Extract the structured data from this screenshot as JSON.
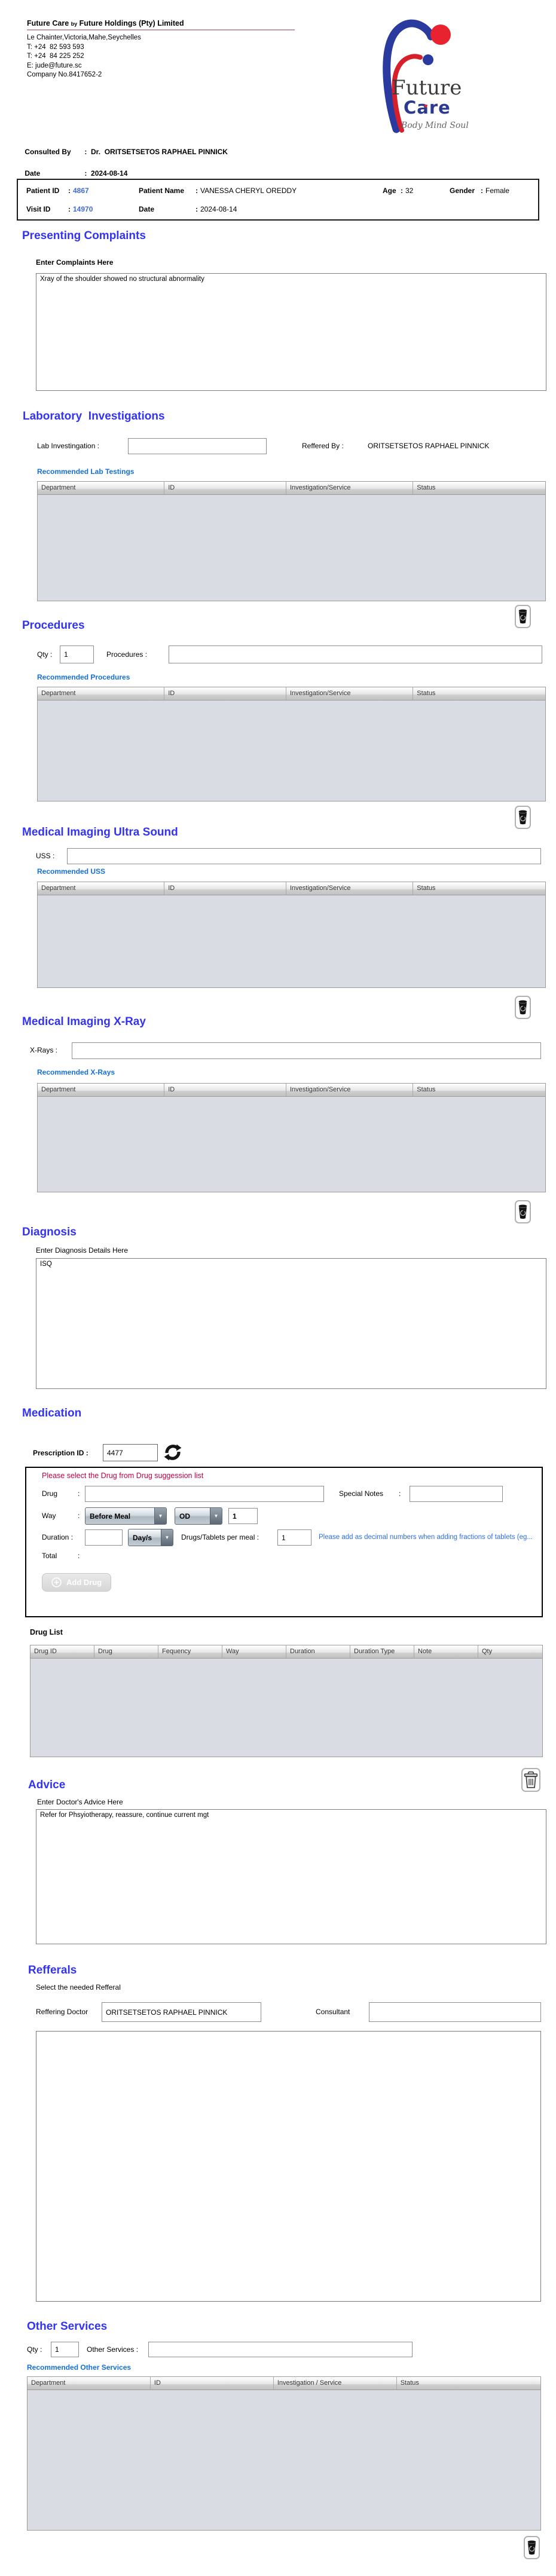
{
  "punct": {
    "colon": ":"
  },
  "colors": {
    "heading_blue": "#3333f2",
    "link_blue": "#156fd6",
    "warning_red": "#c30045",
    "note_blue": "#2e6de5",
    "id_blue": "#4169d8"
  },
  "header": {
    "company_name_1": "Future Care",
    "company_name_by": "by",
    "company_name_2": "Future Holdings (Pty) Limited",
    "address": "Le Chainter,Victoria,Mahe,Seychelles",
    "phone1": "T: +24  82 593 593",
    "phone2": "T: +24  84 225 252",
    "email": "E: jude@future.sc",
    "company_no": "Company No.8417652-2",
    "logo_title": "Future",
    "logo_subtitle": "Care",
    "logo_tagline": "Body Mind Soul"
  },
  "consultation": {
    "consulted_by_label": "Consulted By",
    "consulted_by_value": "Dr.  ORITSETSETOS RAPHAEL PINNICK",
    "date_label": "Date",
    "date_value": "2024-08-14"
  },
  "patient": {
    "patient_id_label": "Patient ID",
    "patient_id": "4867",
    "name_label": "Patient Name",
    "name": "VANESSA CHERYL OREDDY",
    "age_label": "Age",
    "age": "32",
    "gender_label": "Gender",
    "gender": "Female",
    "visit_id_label": "Visit ID",
    "visit_id": "14970",
    "date_label": "Date",
    "date": "2024-08-14"
  },
  "presenting_complaints": {
    "title": "Presenting Complaints",
    "subtitle": "Enter Complaints Here",
    "value": "Xray of the shoulder showed no structural abnormality"
  },
  "laboratory": {
    "title": "Laboratory  Investigations",
    "lab_label": "Lab Investingation :",
    "lab_value": "",
    "reffered_label": "Reffered By :",
    "reffered_value": "ORITSETSETOS RAPHAEL PINNICK",
    "recommended_label": "Recommended Lab Testings",
    "headers": [
      "Department",
      "ID",
      "Investigation/Service",
      "Status"
    ]
  },
  "procedures": {
    "title": "Procedures",
    "qty_label": "Qty :",
    "qty_value": "1",
    "label": "Procedures :",
    "value": "",
    "recommended_label": "Recommended Procedures",
    "headers": [
      "Department",
      "ID",
      "Investigation/Service",
      "Status"
    ]
  },
  "ultrasound": {
    "title": "Medical Imaging Ultra Sound",
    "label": "USS :",
    "value": "",
    "recommended_label": "Recommended USS",
    "headers": [
      "Department",
      "ID",
      "Investigation/Service",
      "Status"
    ]
  },
  "xray": {
    "title": "Medical Imaging X-Ray",
    "label": "X-Rays :",
    "value": "",
    "recommended_label": "Recommended X-Rays",
    "headers": [
      "Department",
      "ID",
      "Investigation/Service",
      "Status"
    ]
  },
  "diagnosis": {
    "title": "Diagnosis",
    "subtitle": "Enter Diagnosis Details Here",
    "value": "ISQ"
  },
  "medication": {
    "title": "Medication",
    "prescription_label": "Prescription ID :",
    "prescription_id": "4477",
    "warning": "Please select the Drug from Drug suggession list",
    "drug_label": "Drug",
    "drug_value": "",
    "special_notes_label": "Special Notes",
    "special_notes_value": "",
    "way_label": "Way",
    "meal_option": "Before Meal",
    "frequency_option": "OD",
    "way_qty": "1",
    "duration_label": "Duration :",
    "duration_value": "",
    "duration_type_option": "Day/s",
    "per_meal_label": "Drugs/Tablets per meal :",
    "per_meal_value": "1",
    "fraction_note": "Please add as decimal numbers when adding fractions of tablets (eg...",
    "total_label": "Total",
    "add_drug_label": "Add Drug",
    "drug_list_label": "Drug List",
    "headers": [
      "Drug ID",
      "Drug",
      "Fequency",
      "Way",
      "Duration",
      "Duration Type",
      "Note",
      "Qty"
    ]
  },
  "advice": {
    "title": "Advice",
    "subtitle": "Enter Doctor's Advice Here",
    "value": "Refer for Phsyiotherapy, reassure, continue current mgt"
  },
  "refferals": {
    "title": "Refferals",
    "subtitle": "Select the needed Refferal",
    "doctor_label": "Reffering Doctor",
    "doctor_value": "ORITSETSETOS RAPHAEL PINNICK",
    "consultant_label": "Consultant",
    "consultant_value": ""
  },
  "other_services": {
    "title": "Other Services",
    "qty_label": "Qty :",
    "qty_value": "1",
    "label": "Other Services :",
    "value": "",
    "recommended_label": "Recommended Other Services",
    "headers": [
      "Department",
      "ID",
      "Investigation / Service",
      "Status"
    ]
  }
}
